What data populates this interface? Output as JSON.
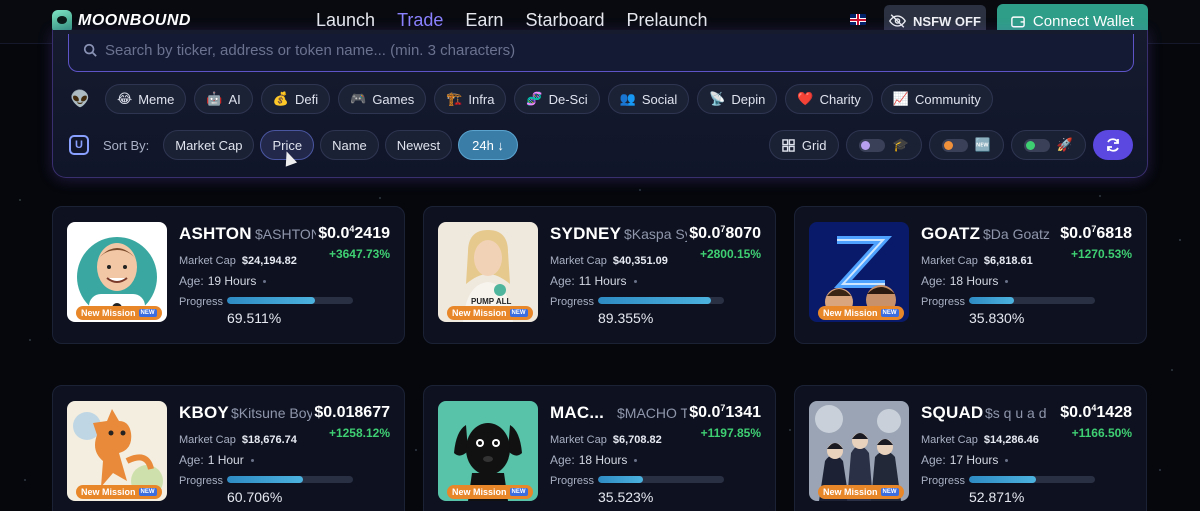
{
  "app": {
    "name": "MOONBOUND"
  },
  "nav": {
    "items": [
      "Launch",
      "Trade",
      "Earn",
      "Starboard",
      "Prelaunch"
    ],
    "active": "Trade"
  },
  "header": {
    "nsfw_label": "NSFW OFF",
    "connect_label": "Connect Wallet"
  },
  "search": {
    "placeholder": "Search by ticker, address or token name... (min. 3 characters)"
  },
  "categories": [
    {
      "icon": "😂",
      "label": "Meme"
    },
    {
      "icon": "🤖",
      "label": "AI"
    },
    {
      "icon": "💰",
      "label": "Defi"
    },
    {
      "icon": "🎮",
      "label": "Games"
    },
    {
      "icon": "🏗️",
      "label": "Infra"
    },
    {
      "icon": "🧬",
      "label": "De-Sci"
    },
    {
      "icon": "👥",
      "label": "Social"
    },
    {
      "icon": "📡",
      "label": "Depin"
    },
    {
      "icon": "❤️",
      "label": "Charity"
    },
    {
      "icon": "📈",
      "label": "Community"
    }
  ],
  "sort": {
    "label": "Sort By:",
    "options": [
      "Market Cap",
      "Price",
      "Name",
      "Newest"
    ],
    "selected": "Price",
    "period": "24h ↓"
  },
  "view": {
    "grid_label": "Grid",
    "toggles": [
      {
        "icon": "🎓",
        "knob_color": "#b7a0f0"
      },
      {
        "icon": "🆕",
        "knob_color": "#f0903a"
      },
      {
        "icon": "🚀",
        "knob_color": "#3fcf73"
      }
    ]
  },
  "labels": {
    "market_cap": "Market Cap",
    "age": "Age:",
    "progress": "Progress",
    "mission": "New Mission",
    "mission_badge": "NEW"
  },
  "tokens": [
    {
      "name": "ASHTON",
      "ticker": "$ASHTON",
      "price_lead": "$0.0",
      "price_sub": "4",
      "price_tail": "2419",
      "change": "+3647.73%",
      "market_cap": "$24,194.82",
      "age": "19 Hours",
      "progress": 69.511,
      "progress_label": "69.511%"
    },
    {
      "name": "SYDNEY",
      "ticker": "$Kaspa Sydney",
      "price_lead": "$0.0",
      "price_sub": "7",
      "price_tail": "8070",
      "change": "+2800.15%",
      "market_cap": "$40,351.09",
      "age": "11 Hours",
      "progress": 89.355,
      "progress_label": "89.355%"
    },
    {
      "name": "GOATZ",
      "ticker": "$Da Goatz",
      "price_lead": "$0.0",
      "price_sub": "7",
      "price_tail": "6818",
      "change": "+1270.53%",
      "market_cap": "$6,818.61",
      "age": "18 Hours",
      "progress": 35.83,
      "progress_label": "35.830%"
    },
    {
      "name": "KBOY",
      "ticker": "$Kitsune Boy",
      "price_lead": "$0.018677",
      "price_sub": "",
      "price_tail": "",
      "change": "+1258.12%",
      "market_cap": "$18,676.74",
      "age": "1 Hour",
      "progress": 60.706,
      "progress_label": "60.706%"
    },
    {
      "name": "MAC...",
      "ticker": "$MACHO THE",
      "price_lead": "$0.0",
      "price_sub": "7",
      "price_tail": "1341",
      "change": "+1197.85%",
      "market_cap": "$6,708.82",
      "age": "18 Hours",
      "progress": 35.523,
      "progress_label": "35.523%"
    },
    {
      "name": "SQUAD",
      "ticker": "$s q u a d",
      "price_lead": "$0.0",
      "price_sub": "4",
      "price_tail": "1428",
      "change": "+1166.50%",
      "market_cap": "$14,286.46",
      "age": "17 Hours",
      "progress": 52.871,
      "progress_label": "52.871%"
    }
  ],
  "colors": {
    "accent": "#8b82ff",
    "connect": "#2f9e88",
    "positive": "#3fcf73",
    "mission": "#e8862a"
  }
}
